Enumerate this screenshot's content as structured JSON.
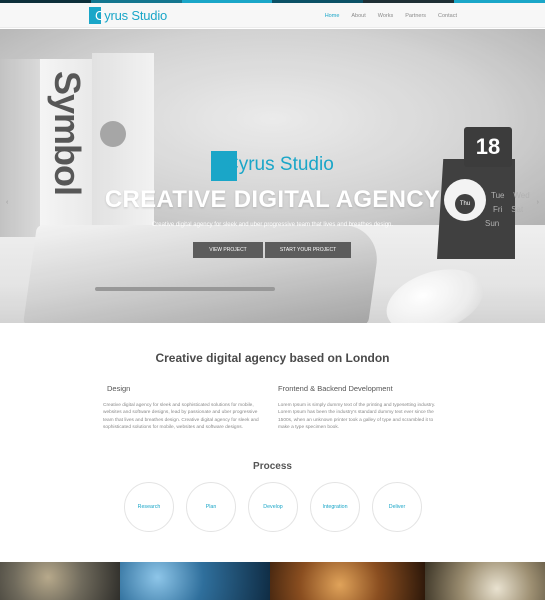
{
  "brand": {
    "name": "Cyrus Studio",
    "accent_color": "#1aa6c8"
  },
  "top_strip_colors": [
    "#0d2f3a",
    "#14768f",
    "#1aa6c8",
    "#0b5166",
    "#1f2f35",
    "#1aa6c8"
  ],
  "nav": {
    "items": [
      {
        "label": "Home",
        "active": true
      },
      {
        "label": "About",
        "active": false
      },
      {
        "label": "Works",
        "active": false
      },
      {
        "label": "Partners",
        "active": false
      },
      {
        "label": "Contact",
        "active": false
      }
    ]
  },
  "hero": {
    "brand_name": "Cyrus Studio",
    "title": "CREATIVE DIGITAL AGENCY",
    "subtitle": "Creative digital agency for sleek and uber progressive team that lives and breathes design.",
    "book_text": "Symbol",
    "calendar_number": "18",
    "calendar_center": "Thu",
    "calendar_days": [
      "Tue",
      "Wed",
      "Fri",
      "Sat",
      "Sun"
    ],
    "prev_arrow": "‹",
    "next_arrow": "›",
    "buttons": {
      "primary": "VIEW PROJECT",
      "secondary": "START YOUR PROJECT"
    }
  },
  "about": {
    "title": "Creative digital agency based on London",
    "columns": [
      {
        "heading": "Design",
        "text": "Creative digital agency for sleek and sophisticated solutions for mobile, websites and software designs, lead by passionate and uber progressive team that lives and breathes design. Creative digital agency for sleek and sophisticated solutions for mobile, websites and software designs."
      },
      {
        "heading": "Frontend & Backend Development",
        "text": "Lorem Ipsum is simply dummy text of the printing and typesetting industry. Lorem Ipsum has been the industry's standard dummy text ever since the 1500s, when an unknown printer took a galley of type and scrambled it to make a type specimen book."
      }
    ]
  },
  "process": {
    "title": "Process",
    "steps": [
      "Research",
      "Plan",
      "Develop",
      "Integration",
      "Deliver"
    ]
  }
}
